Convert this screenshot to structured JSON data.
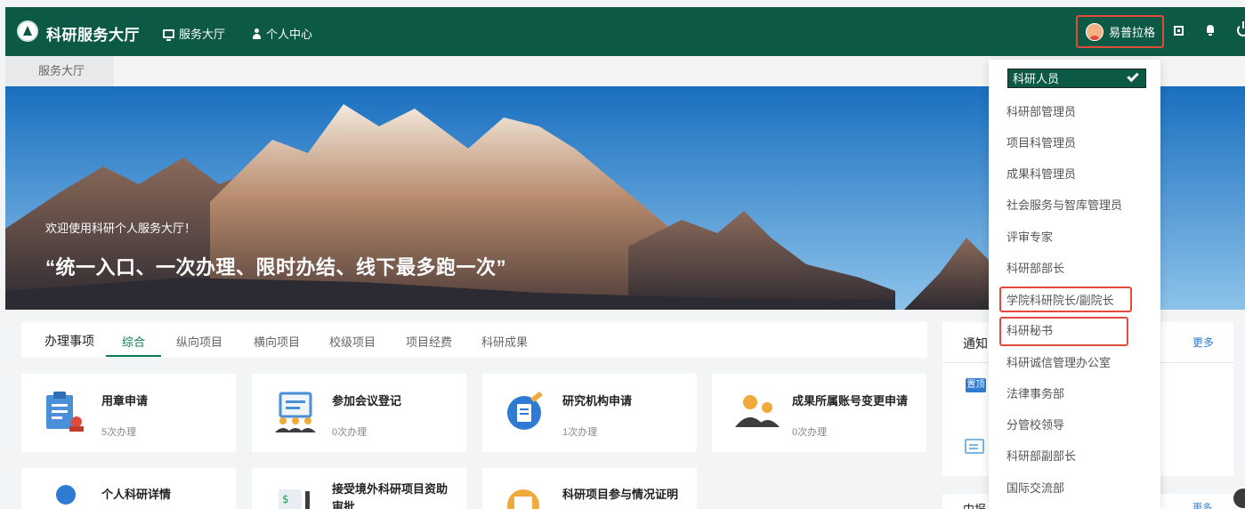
{
  "header": {
    "brand": "科研服务大厅",
    "nav": [
      "服务大厅",
      "个人中心"
    ],
    "user_name": "易普拉格"
  },
  "breadcrumb": "服务大厅",
  "banner": {
    "welcome": "欢迎使用科研个人服务大厅！",
    "slogan": "“统一入口、一次办理、限时办结、线下最多跑一次”"
  },
  "tasks": {
    "title": "办理事项",
    "tabs": [
      "综合",
      "纵向项目",
      "横向项目",
      "校级项目",
      "项目经费",
      "科研成果"
    ],
    "active_tab": "综合",
    "cards": [
      {
        "title": "用章申请",
        "count": "5次办理",
        "icon": "stamp-document-icon"
      },
      {
        "title": "参加会议登记",
        "count": "0次办理",
        "icon": "meeting-board-icon"
      },
      {
        "title": "研究机构申请",
        "count": "1次办理",
        "icon": "institution-edit-icon"
      },
      {
        "title": "成果所属账号变更申请",
        "count": "0次办理",
        "icon": "account-users-icon"
      },
      {
        "title": "个人科研详情",
        "count": "",
        "icon": "personal-research-icon"
      },
      {
        "title": "接受境外科研项目资助审批",
        "count": "",
        "icon": "funding-document-icon"
      },
      {
        "title": "科研项目参与情况证明",
        "count": "",
        "icon": "certificate-folder-icon"
      }
    ]
  },
  "notice": {
    "title": "通知公告",
    "title_visible": "通知",
    "more": "更多",
    "top_badge": "置顶",
    "second_title": "申报",
    "second_title_visible": "中报",
    "second_more": "更多"
  },
  "role_dropdown": {
    "selected": "科研人员",
    "items": [
      "科研部管理员",
      "项目科管理员",
      "成果科管理员",
      "社会服务与智库管理员",
      "评审专家",
      "科研部部长",
      "学院科研院长/副院长",
      "科研秘书",
      "科研诚信管理办公室",
      "法律事务部",
      "分管校领导",
      "科研部副部长",
      "国际交流部"
    ],
    "highlighted": [
      "学院科研院长/副院长",
      "科研秘书"
    ]
  },
  "colors": {
    "primary": "#0c5a45",
    "accent_green": "#0c7a57",
    "highlight_red": "#e24a3b",
    "link_blue": "#2f7ad3"
  }
}
